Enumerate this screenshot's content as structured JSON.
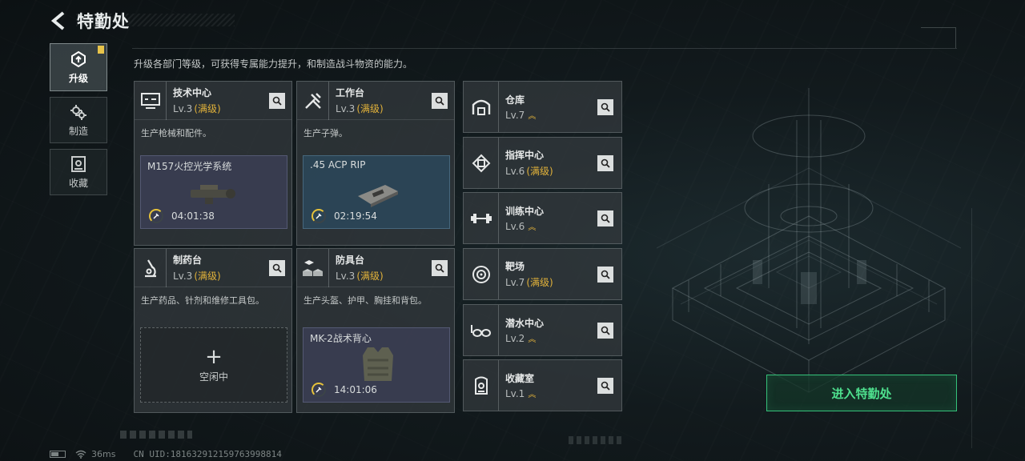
{
  "header": {
    "title": "特勤处"
  },
  "nav": [
    {
      "label": "升级",
      "icon": "upgrade-icon",
      "active": true,
      "badge": "!"
    },
    {
      "label": "制造",
      "icon": "gears-icon",
      "active": false
    },
    {
      "label": "收藏",
      "icon": "collection-icon",
      "active": false
    }
  ],
  "description": "升级各部门等级，可获得专属能力提升，和制造战斗物资的能力。",
  "cards": [
    {
      "name": "技术中心",
      "level": "Lv.3",
      "status": "(满级)",
      "desc": "生产枪械和配件。",
      "icon": "computer-icon",
      "craft": {
        "item": "M157火控光学系统",
        "time": "04:01:38"
      }
    },
    {
      "name": "工作台",
      "level": "Lv.3",
      "status": "(满级)",
      "desc": "生产子弹。",
      "icon": "tools-icon",
      "craft": {
        "item": ".45 ACP RIP",
        "time": "02:19:54"
      }
    },
    {
      "name": "制药台",
      "level": "Lv.3",
      "status": "(满级)",
      "desc": "生产药品、针剂和维修工具包。",
      "icon": "microscope-icon",
      "idle": {
        "label": "空闲中",
        "plus": "+"
      }
    },
    {
      "name": "防具台",
      "level": "Lv.3",
      "status": "(满级)",
      "desc": "生产头盔、护甲、胸挂和背包。",
      "icon": "armor-blocks-icon",
      "craft": {
        "item": "MK-2战术背心",
        "time": "14:01:06"
      }
    }
  ],
  "facilities": [
    {
      "name": "仓库",
      "level": "Lv.7",
      "status": "",
      "upgradable": true,
      "icon": "warehouse-icon"
    },
    {
      "name": "指挥中心",
      "level": "Lv.6",
      "status": "(满级)",
      "upgradable": false,
      "icon": "chip-icon"
    },
    {
      "name": "训练中心",
      "level": "Lv.6",
      "status": "",
      "upgradable": true,
      "icon": "dumbbell-icon"
    },
    {
      "name": "靶场",
      "level": "Lv.7",
      "status": "(满级)",
      "upgradable": false,
      "icon": "target-icon"
    },
    {
      "name": "潜水中心",
      "level": "Lv.2",
      "status": "",
      "upgradable": true,
      "icon": "goggles-icon"
    },
    {
      "name": "收藏室",
      "level": "Lv.1",
      "status": "",
      "upgradable": true,
      "icon": "vault-icon"
    }
  ],
  "enter_button": "进入特勤处",
  "status_bar": {
    "ping": "36ms",
    "uid": "CN UID:181632912159763998814"
  },
  "colors": {
    "accent_gold": "#e2b23a",
    "accent_green": "#4ee08e",
    "card_bg": "#343a3e"
  }
}
